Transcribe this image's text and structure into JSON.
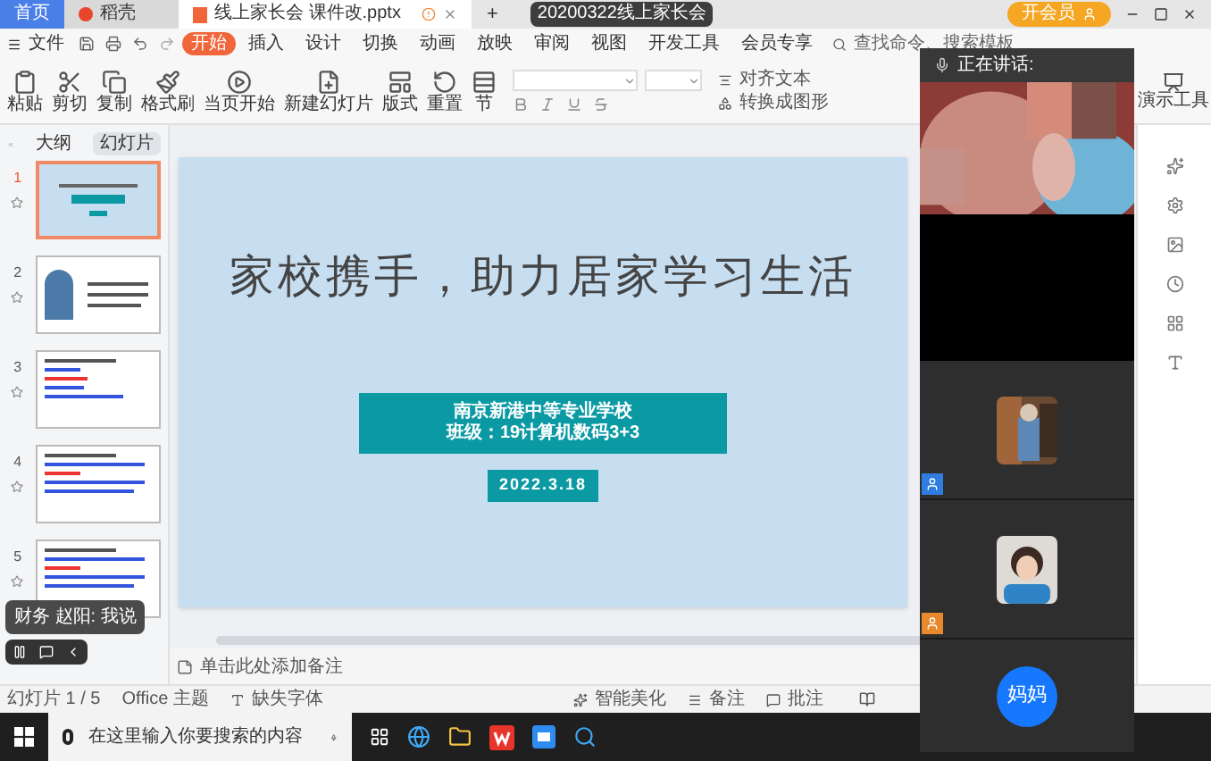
{
  "tabs": [
    {
      "label": "首页",
      "kind": "home",
      "selected": false
    },
    {
      "label": "稻壳",
      "kind": "docer",
      "selected": false
    },
    {
      "label": "线上家长会 课件改.pptx",
      "kind": "doc",
      "selected": true
    }
  ],
  "new_tab": "+",
  "meeting_badge": "20200322线上家长会",
  "vip_button": "开会员",
  "menu": {
    "file": "文件",
    "tabs": [
      {
        "label": "开始",
        "selected": true
      },
      {
        "label": "插入",
        "selected": false
      },
      {
        "label": "设计",
        "selected": false
      },
      {
        "label": "切换",
        "selected": false
      },
      {
        "label": "动画",
        "selected": false
      },
      {
        "label": "放映",
        "selected": false
      },
      {
        "label": "审阅",
        "selected": false
      },
      {
        "label": "视图",
        "selected": false
      },
      {
        "label": "开发工具",
        "selected": false
      },
      {
        "label": "会员专享",
        "selected": false
      }
    ]
  },
  "search": {
    "placeholder": "查找命令、搜索模板"
  },
  "toolbar": [
    {
      "label": "粘贴",
      "kind": "large"
    },
    {
      "label": "剪切",
      "kind": "large"
    },
    {
      "label": "复制",
      "kind": "large"
    },
    {
      "label": "格式刷",
      "kind": "large"
    },
    {
      "label": "当页开始",
      "kind": "large"
    },
    {
      "label": "新建幻灯片",
      "kind": "large"
    },
    {
      "label": "版式",
      "kind": "large"
    },
    {
      "label": "重置",
      "kind": "large"
    },
    {
      "label": "节",
      "kind": "large"
    },
    {
      "label": "对齐文本",
      "kind": "small"
    },
    {
      "label": "转换成图形",
      "kind": "small"
    },
    {
      "label": "演示工具",
      "kind": "side"
    }
  ],
  "panel_tabs": [
    {
      "label": "大纲",
      "selected": false
    },
    {
      "label": "幻灯片",
      "selected": true
    }
  ],
  "thumbnails": [
    {
      "number": "1",
      "kind": "title",
      "selected": true
    },
    {
      "number": "2",
      "kind": "figure",
      "selected": false
    },
    {
      "number": "3",
      "kind": "list",
      "selected": false
    },
    {
      "number": "4",
      "kind": "text",
      "selected": false
    },
    {
      "number": "5",
      "kind": "text",
      "selected": false
    }
  ],
  "toast": "财务 赵阳: 我说",
  "slide": {
    "title": "家校携手，助力居家学习生活",
    "school_lines": [
      "南京新港中等专业学校",
      "班级：19计算机数码3+3"
    ],
    "date": "2022.3.18"
  },
  "notes_placeholder": "单击此处添加备注",
  "status": {
    "slide_count": "幻灯片 1 / 5",
    "theme": "Office 主题",
    "missing_fonts": "缺失字体",
    "beautify": "智能美化",
    "notes": "备注",
    "comments": "批注"
  },
  "taskbar": {
    "search_placeholder": "在这里输入你要搜索的内容"
  },
  "video": {
    "header": "正在讲话:",
    "tiles": [
      {
        "kind": "video"
      },
      {
        "kind": "blank"
      },
      {
        "kind": "avatar",
        "color": "#2f7de1"
      },
      {
        "kind": "avatar",
        "color": "#e8892b"
      },
      {
        "kind": "name",
        "label": "妈妈"
      }
    ]
  }
}
